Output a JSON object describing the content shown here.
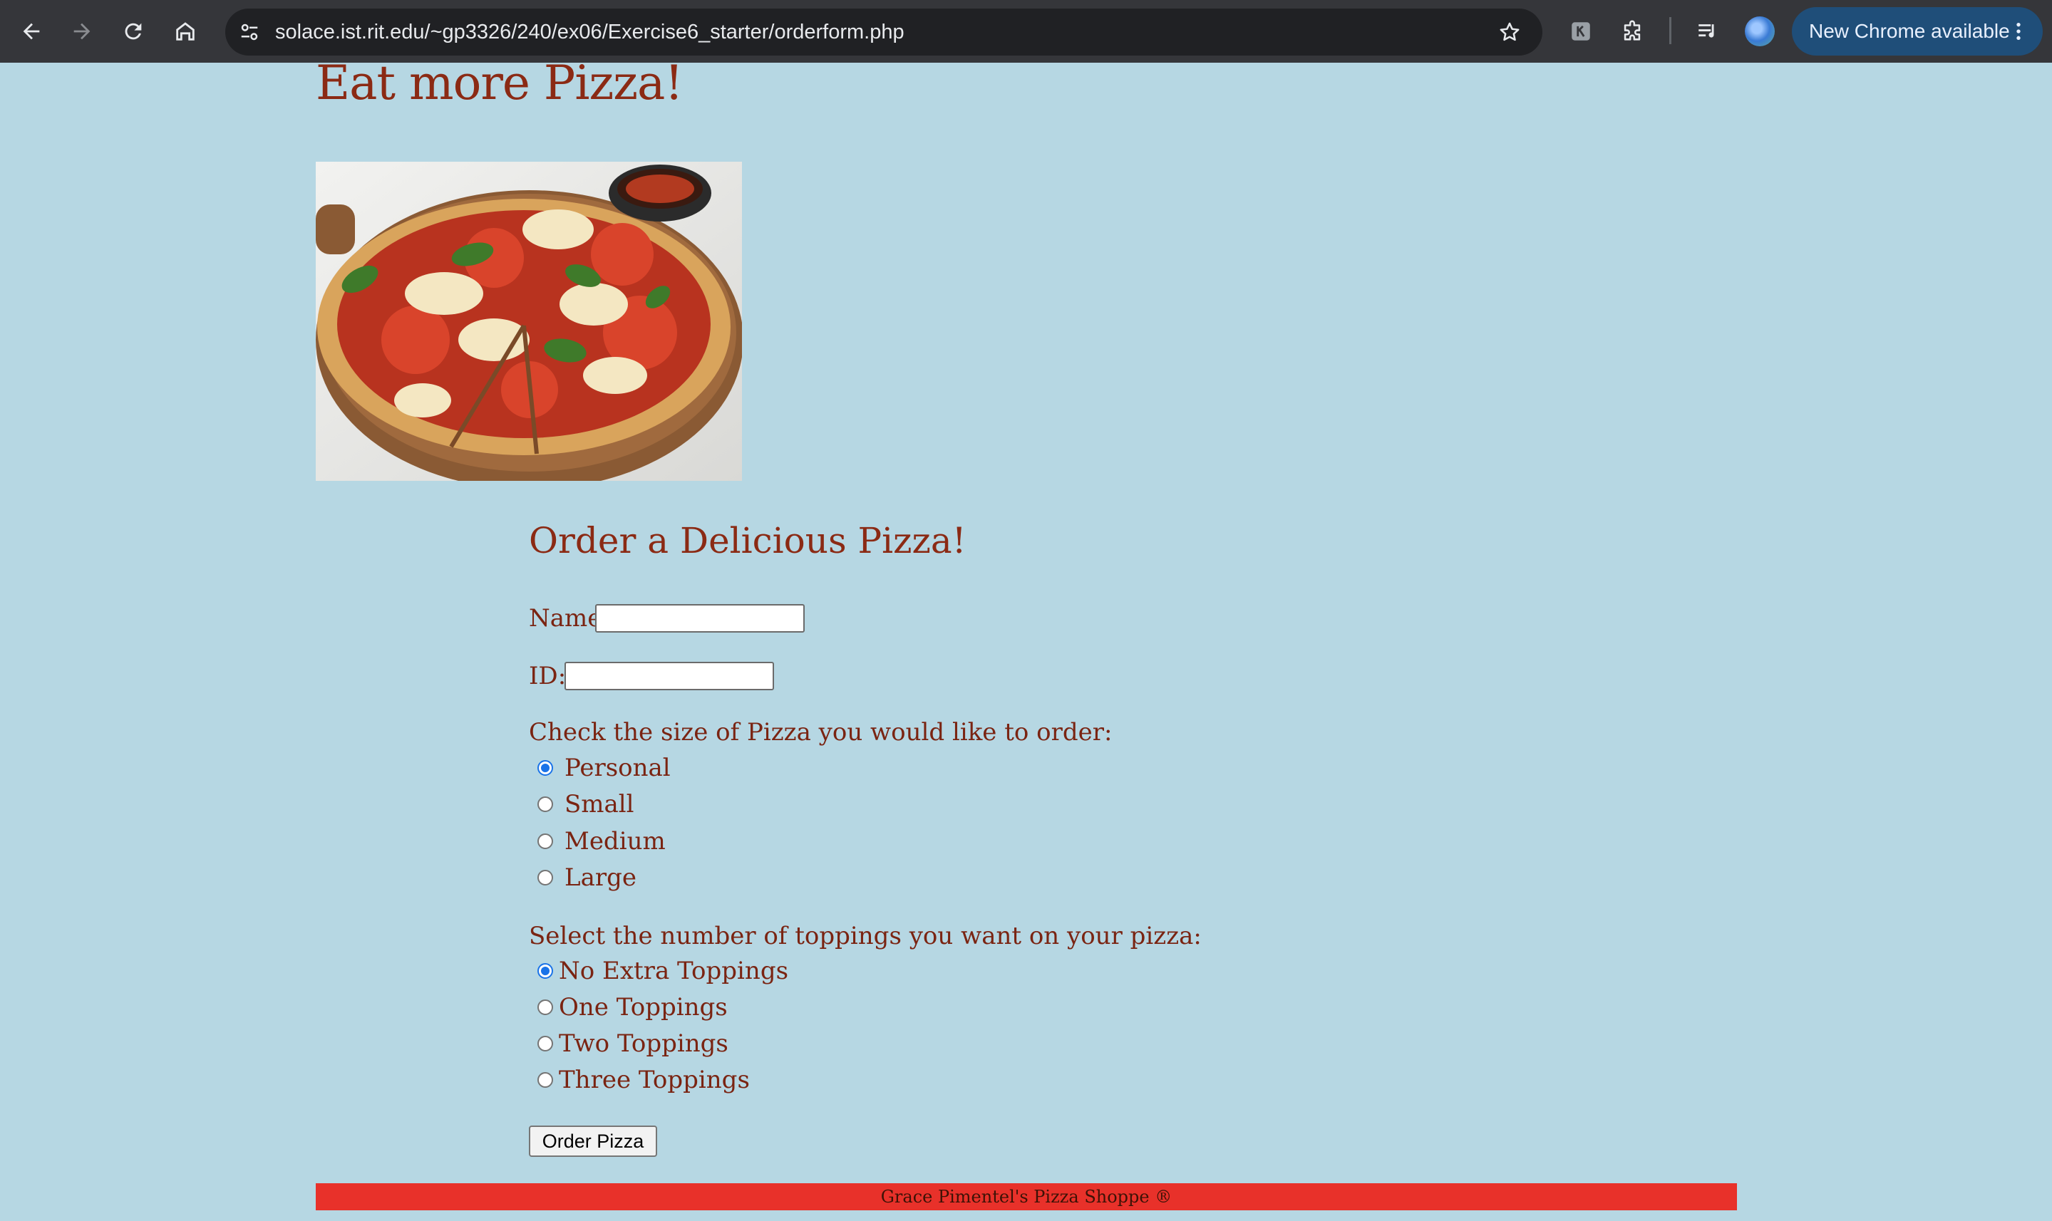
{
  "browser": {
    "url": "solace.ist.rit.edu/~gp3326/240/ex06/Exercise6_starter/orderform.php",
    "update_label": "New Chrome available",
    "icons": [
      "back-arrow-icon",
      "forward-arrow-icon",
      "reload-icon",
      "home-icon",
      "site-info-icon",
      "bookmark-star-icon",
      "extension-k-icon",
      "extensions-puzzle-icon",
      "media-control-icon",
      "profile-avatar-icon",
      "more-vert-icon"
    ]
  },
  "page": {
    "title": "Eat more Pizza!",
    "order_heading": "Order a Delicious Pizza!",
    "name_label": "Name:",
    "name_value": "",
    "id_label": "ID:",
    "id_value": "",
    "size_prompt": "Check the size of Pizza you would like to order:",
    "sizes": [
      {
        "label": "Personal",
        "checked": true
      },
      {
        "label": "Small",
        "checked": false
      },
      {
        "label": "Medium",
        "checked": false
      },
      {
        "label": "Large",
        "checked": false
      }
    ],
    "toppings_prompt": "Select the number of toppings you want on your pizza:",
    "toppings": [
      {
        "label": "No Extra Toppings",
        "checked": true
      },
      {
        "label": "One Toppings",
        "checked": false
      },
      {
        "label": "Two Toppings",
        "checked": false
      },
      {
        "label": "Three Toppings",
        "checked": false
      }
    ],
    "submit_label": "Order Pizza",
    "footer": "Grace Pimentel's Pizza Shoppe ®"
  },
  "colors": {
    "page_bg": "#b6d7e3",
    "heading": "#8b2a14",
    "footer_bg": "#e8312a",
    "radio_accent": "#1a73e8",
    "chrome_bg": "#35363a"
  }
}
